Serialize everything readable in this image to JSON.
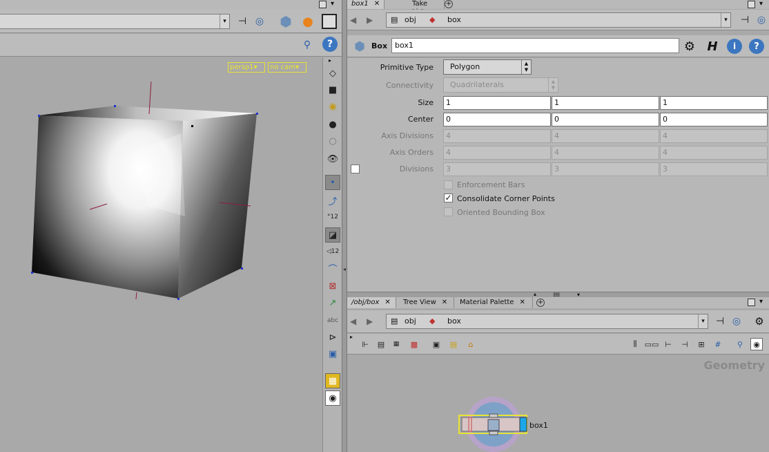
{
  "viewport": {
    "camera_menu": "persp1▾",
    "cam_menu": "no cam▾"
  },
  "param_tabs": [
    {
      "label": "box1",
      "close": "✕"
    },
    {
      "label": "Take List",
      "close": ""
    }
  ],
  "param_path": {
    "root": "obj",
    "node": "box"
  },
  "node": {
    "type_label": "Box",
    "name": "box1"
  },
  "params": {
    "primitive_type": {
      "label": "Primitive Type",
      "value": "Polygon"
    },
    "connectivity": {
      "label": "Connectivity",
      "value": "Quadrilaterals"
    },
    "size": {
      "label": "Size",
      "values": [
        "1",
        "1",
        "1"
      ]
    },
    "center": {
      "label": "Center",
      "values": [
        "0",
        "0",
        "0"
      ]
    },
    "axis_divisions": {
      "label": "Axis Divisions",
      "values": [
        "4",
        "4",
        "4"
      ]
    },
    "axis_orders": {
      "label": "Axis Orders",
      "values": [
        "4",
        "4",
        "4"
      ]
    },
    "divisions": {
      "label": "Divisions",
      "values": [
        "3",
        "3",
        "3"
      ]
    },
    "enforcement_bars": {
      "label": "Enforcement Bars",
      "checked": false
    },
    "consolidate_corner_points": {
      "label": "Consolidate Corner Points",
      "checked": true,
      "mark": "✓"
    },
    "oriented_bounding_box": {
      "label": "Oriented Bounding Box",
      "checked": false
    }
  },
  "net_tabs": [
    {
      "label": "/obj/box",
      "close": "✕"
    },
    {
      "label": "Tree View",
      "close": "✕"
    },
    {
      "label": "Material Palette",
      "close": "✕"
    }
  ],
  "net_path": {
    "root": "obj",
    "node": "box"
  },
  "network": {
    "context_label": "Geometry",
    "node_label": "box1"
  },
  "glyphs": {
    "plus": "+",
    "dropdown": "▾",
    "back": "◀",
    "forward": "▶"
  },
  "colors": {
    "selection_yellow": "#e9e433",
    "display_flag_blue": "#1ea7e8"
  }
}
